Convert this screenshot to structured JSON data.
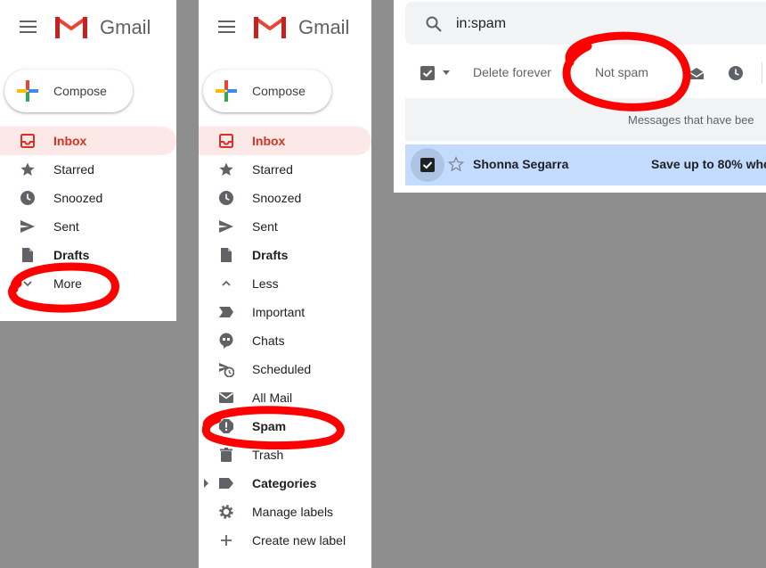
{
  "app": {
    "brand": "Gmail"
  },
  "colors": {
    "accent_red": "#d93025",
    "active_bg": "#fce8e6",
    "selected_row": "#c2dbff",
    "annotation": "#ff0000"
  },
  "panel1": {
    "compose_label": "Compose",
    "nav": [
      {
        "label": "Inbox",
        "icon": "inbox-icon",
        "state": "active"
      },
      {
        "label": "Starred",
        "icon": "star-icon"
      },
      {
        "label": "Snoozed",
        "icon": "clock-icon"
      },
      {
        "label": "Sent",
        "icon": "send-icon"
      },
      {
        "label": "Drafts",
        "icon": "draft-icon",
        "bold": true
      },
      {
        "label": "More",
        "icon": "chevron-down-icon"
      }
    ]
  },
  "panel2": {
    "compose_label": "Compose",
    "nav": [
      {
        "label": "Inbox",
        "icon": "inbox-icon",
        "state": "active"
      },
      {
        "label": "Starred",
        "icon": "star-icon"
      },
      {
        "label": "Snoozed",
        "icon": "clock-icon"
      },
      {
        "label": "Sent",
        "icon": "send-icon"
      },
      {
        "label": "Drafts",
        "icon": "draft-icon",
        "bold": true
      },
      {
        "label": "Less",
        "icon": "chevron-up-icon"
      },
      {
        "label": "Important",
        "icon": "important-icon"
      },
      {
        "label": "Chats",
        "icon": "chat-icon"
      },
      {
        "label": "Scheduled",
        "icon": "scheduled-icon"
      },
      {
        "label": "All Mail",
        "icon": "all-mail-icon"
      },
      {
        "label": "Spam",
        "icon": "spam-icon",
        "bold": true
      },
      {
        "label": "Trash",
        "icon": "trash-icon"
      },
      {
        "label": "Categories",
        "icon": "label-icon",
        "bold": true
      },
      {
        "label": "Manage labels",
        "icon": "gear-icon"
      },
      {
        "label": "Create new label",
        "icon": "plus-icon"
      }
    ]
  },
  "panel3": {
    "search_query": "in:spam",
    "toolbar": {
      "delete_forever": "Delete forever",
      "not_spam": "Not spam"
    },
    "notice": "Messages that have bee",
    "row": {
      "sender": "Shonna Segarra",
      "subject": "Save up to 80% whe"
    }
  }
}
